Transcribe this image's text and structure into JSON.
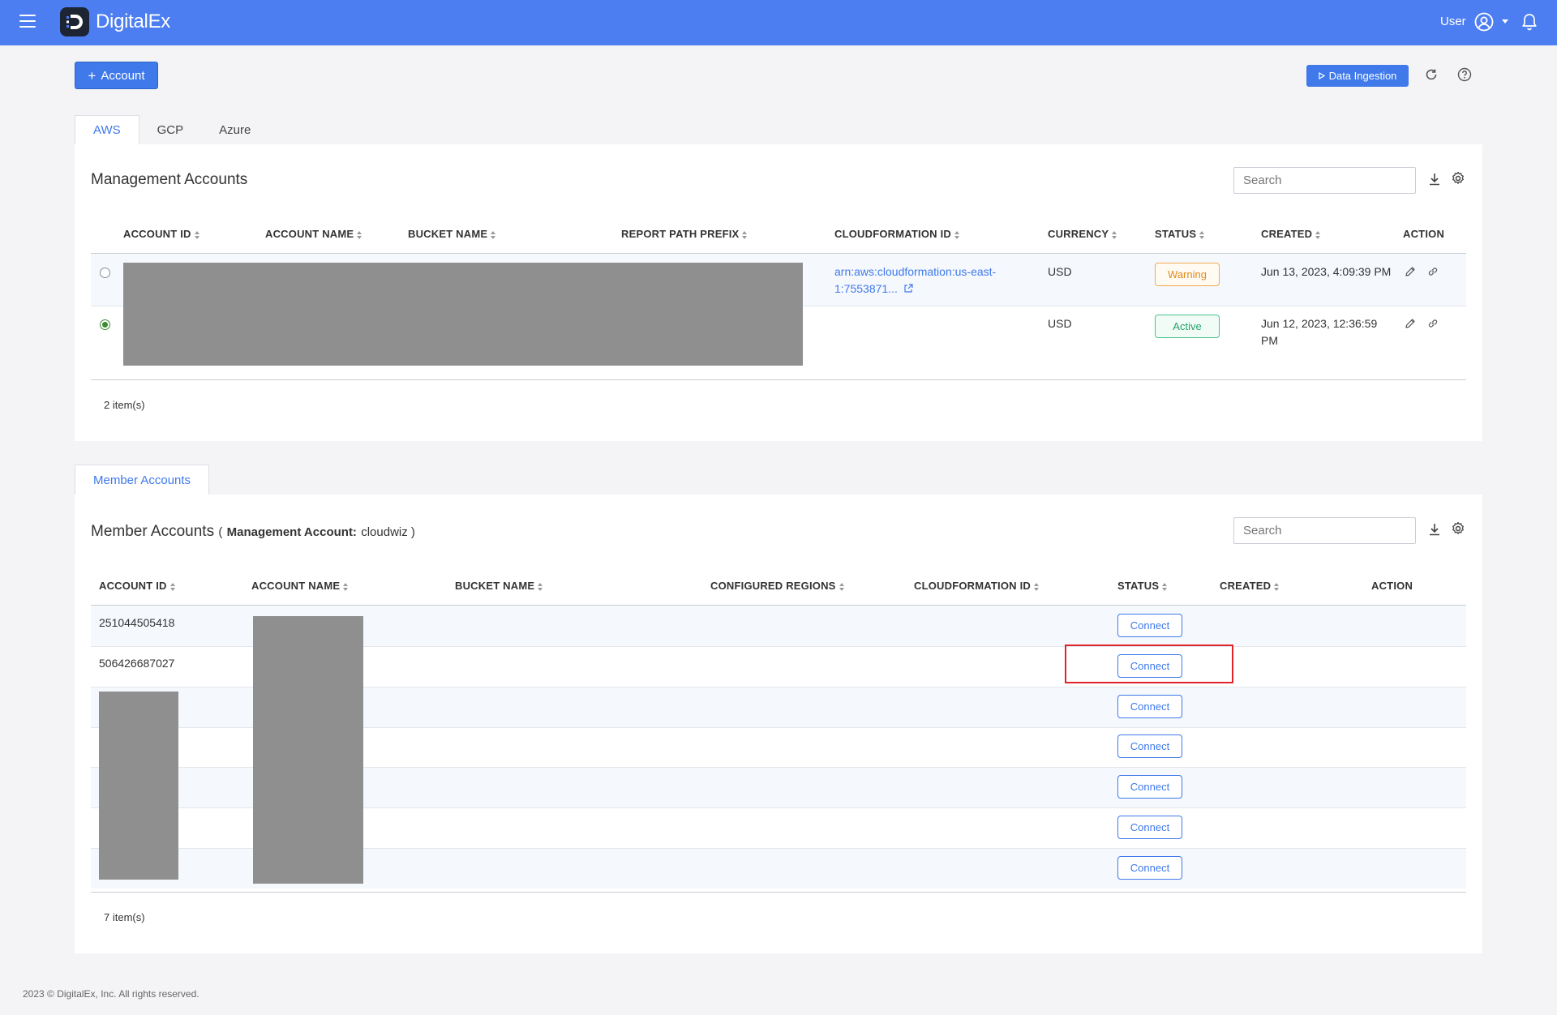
{
  "app": {
    "name": "DigitalEx",
    "user_label": "User",
    "brand_color": "#4c7ef1"
  },
  "toolbar": {
    "add_account_label": "Account",
    "data_ingestion_label": "Data Ingestion"
  },
  "cloud_tabs": [
    "AWS",
    "GCP",
    "Azure"
  ],
  "management": {
    "title": "Management Accounts",
    "search_placeholder": "Search",
    "columns": [
      "ACCOUNT ID",
      "ACCOUNT NAME",
      "BUCKET NAME",
      "REPORT PATH PREFIX",
      "CLOUDFORMATION ID",
      "CURRENCY",
      "STATUS",
      "CREATED",
      "ACTION"
    ],
    "rows": [
      {
        "selected": false,
        "cloudformation_line1": "arn:aws:cloudformation:us-east-",
        "cloudformation_line2": "1:7553871...",
        "currency": "USD",
        "status": "Warning",
        "created_line1": "Jun 13, 2023, 4:09:39 PM",
        "created_line2": ""
      },
      {
        "selected": true,
        "cloudformation_line1": "",
        "cloudformation_line2": "",
        "currency": "USD",
        "status": "Active",
        "created_line1": "Jun 12, 2023, 12:36:59",
        "created_line2": "PM"
      }
    ],
    "items_count": "2 item(s)"
  },
  "member": {
    "tab_label": "Member Accounts",
    "title": "Member Accounts",
    "mgmt_prefix": "(",
    "mgmt_label": "Management Account:",
    "mgmt_value": "cloudwiz )",
    "search_placeholder": "Search",
    "columns": [
      "ACCOUNT ID",
      "ACCOUNT NAME",
      "BUCKET NAME",
      "CONFIGURED REGIONS",
      "CLOUDFORMATION ID",
      "STATUS",
      "CREATED",
      "ACTION"
    ],
    "rows": [
      {
        "account_id": "251044505418",
        "status": "Connect"
      },
      {
        "account_id": "506426687027",
        "status": "Connect"
      },
      {
        "account_id": "",
        "status": "Connect"
      },
      {
        "account_id": "",
        "status": "Connect"
      },
      {
        "account_id": "",
        "status": "Connect"
      },
      {
        "account_id": "",
        "status": "Connect"
      },
      {
        "account_id": "",
        "status": "Connect"
      }
    ],
    "items_count": "7 item(s)"
  },
  "footer": "2023 © DigitalEx, Inc. All rights reserved."
}
